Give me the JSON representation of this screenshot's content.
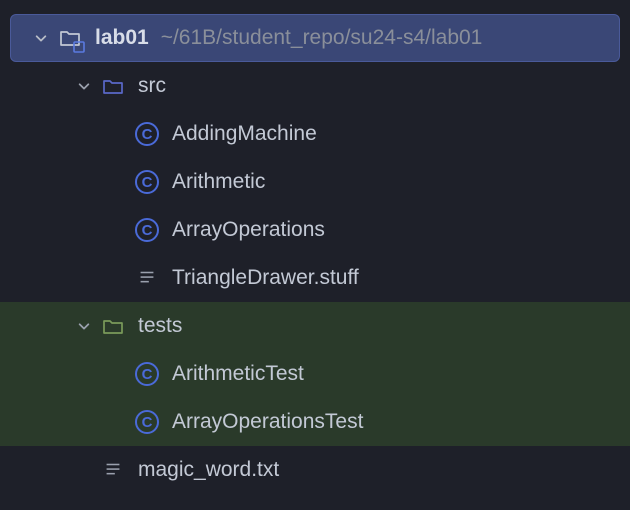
{
  "root": {
    "name": "lab01",
    "path": "~/61B/student_repo/su24-s4/lab01"
  },
  "src": {
    "name": "src",
    "children": {
      "addingMachine": "AddingMachine",
      "arithmetic": "Arithmetic",
      "arrayOperations": "ArrayOperations",
      "triangleDrawer": "TriangleDrawer.stuff"
    }
  },
  "tests": {
    "name": "tests",
    "children": {
      "arithmeticTest": "ArithmeticTest",
      "arrayOperationsTest": "ArrayOperationsTest"
    }
  },
  "magicWord": "magic_word.txt"
}
